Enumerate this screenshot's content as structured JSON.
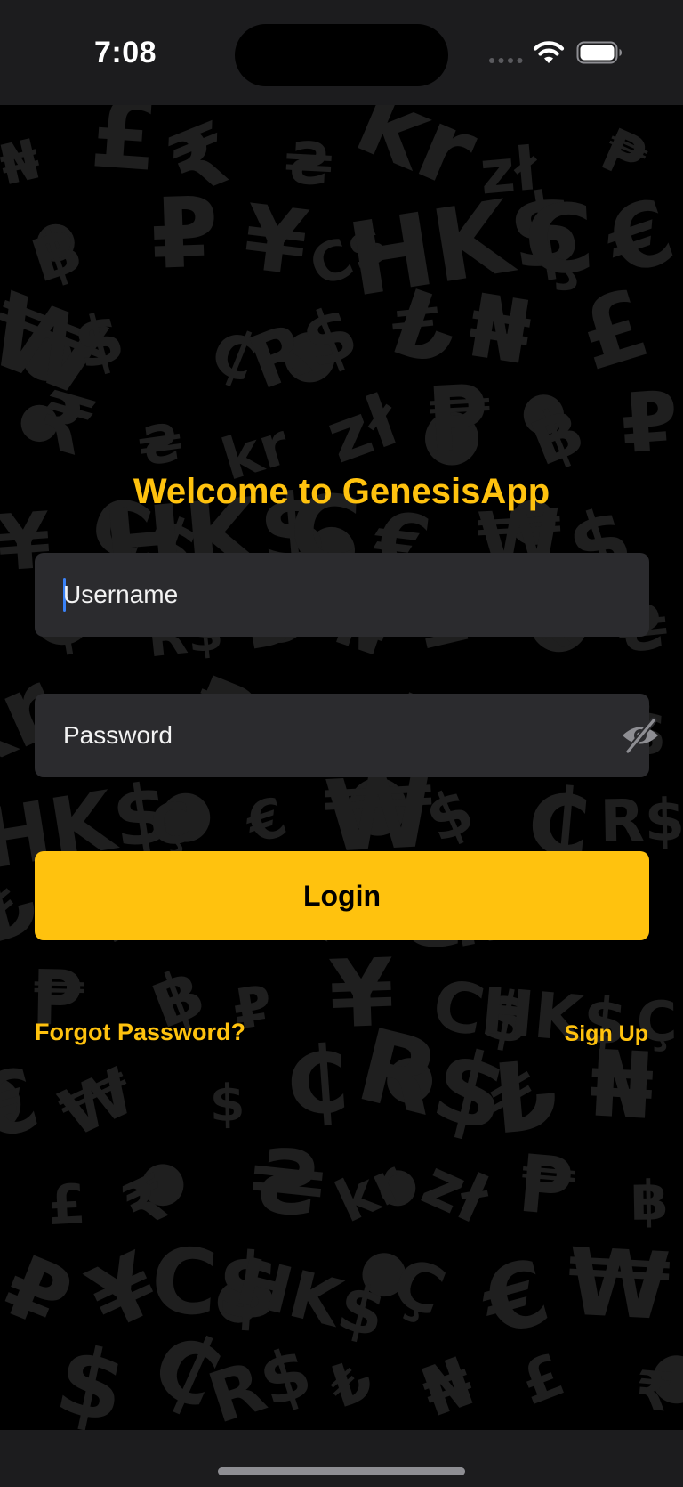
{
  "status_bar": {
    "time": "7:08",
    "icons": [
      "signal-dots-icon",
      "wifi-icon",
      "battery-icon"
    ]
  },
  "background": {
    "pattern_icon": "currency-symbols-pattern",
    "symbols": [
      "₦",
      "€",
      "฿",
      "£",
      "₩",
      "₽",
      "₹",
      "$",
      "¥",
      "₴",
      "₵",
      "C$",
      "kr",
      "R$",
      "HK$",
      "zł",
      "₺",
      "Ç",
      "₱"
    ],
    "color": "#000000",
    "symbol_color": "#1f1f1f"
  },
  "login": {
    "title": "Welcome to GenesisApp",
    "username_placeholder": "Username",
    "username_value": "",
    "password_placeholder": "Password",
    "password_value": "",
    "password_toggle_icon": "eye-slash-icon",
    "login_label": "Login",
    "forgot_password_label": "Forgot Password?",
    "sign_up_label": "Sign Up"
  },
  "colors": {
    "accent": "#ffc20e",
    "field_background": "#2b2b2e",
    "caret": "#3a82f7",
    "bar_background": "#1c1c1e"
  }
}
